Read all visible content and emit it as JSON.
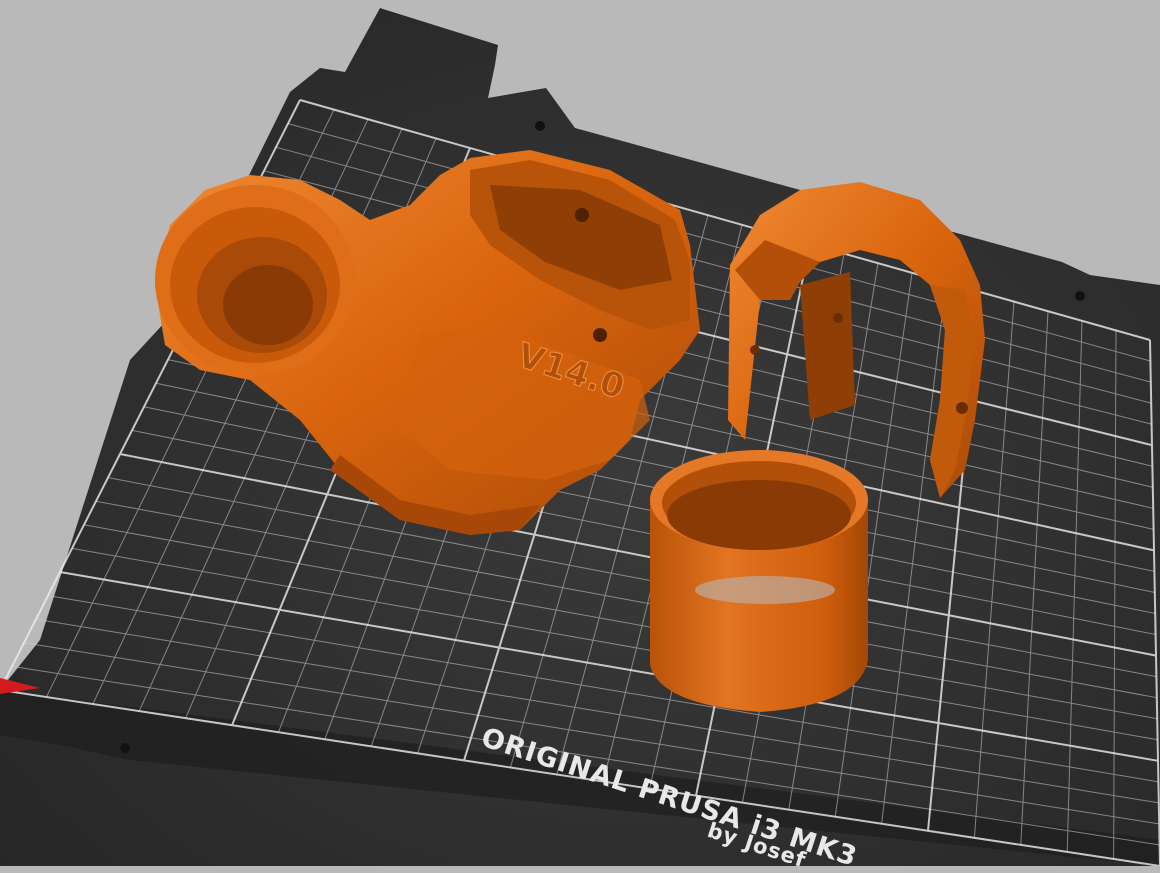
{
  "bed": {
    "label_line1": "ORIGINAL PRUSA i3 MK3",
    "label_line2": "by Josef"
  },
  "parts": [
    {
      "name": "fan-duct-body",
      "embossed_text": "V14.0"
    },
    {
      "name": "shroud-arch",
      "embossed_text": ""
    },
    {
      "name": "ring",
      "embossed_text": ""
    }
  ],
  "colors": {
    "background": "#b9b9b9",
    "bed": "#2e2e2e",
    "grid": "#d8d8d8",
    "part": "#d9640d",
    "part_shadow": "#9a4206",
    "part_highlight": "#f0852e"
  }
}
